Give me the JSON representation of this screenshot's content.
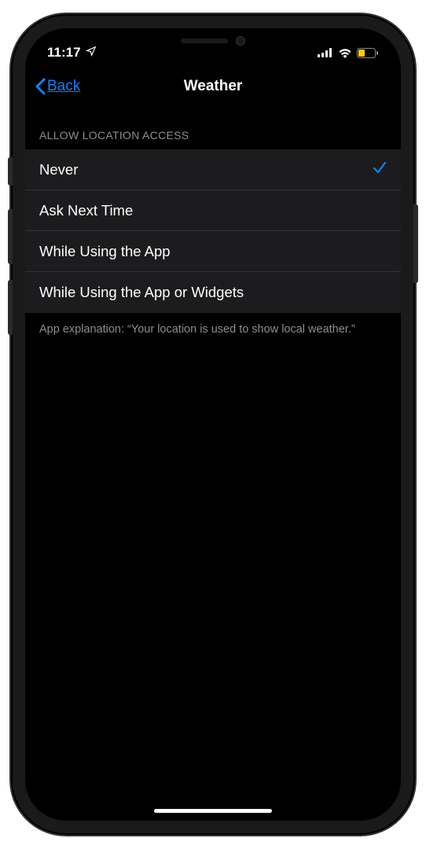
{
  "status": {
    "time": "11:17",
    "location_arrow": true,
    "signal_bars": 4,
    "wifi": true,
    "battery_low_power": true
  },
  "nav": {
    "back_label": "Back",
    "title": "Weather"
  },
  "section": {
    "header": "Allow Location Access",
    "options": [
      {
        "label": "Never",
        "selected": true
      },
      {
        "label": "Ask Next Time",
        "selected": false
      },
      {
        "label": "While Using the App",
        "selected": false
      },
      {
        "label": "While Using the App or Widgets",
        "selected": false
      }
    ],
    "footer": "App explanation: “Your location is used to show local weather.”"
  }
}
